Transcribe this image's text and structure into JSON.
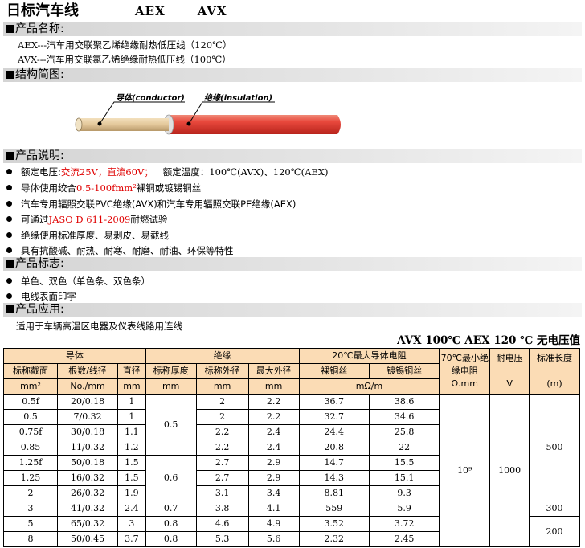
{
  "title": {
    "main": "日标汽车线",
    "code_a": "AEX",
    "code_b": "AVX"
  },
  "sections": {
    "name": "产品名称:",
    "structure": "结构简图:",
    "description": "产品说明:",
    "marking": "产品标志:",
    "application": "产品应用:"
  },
  "names": [
    "AEX---汽车用交联聚乙烯绝缘耐热低压线（120℃）",
    "AVX---汽车用交联氯乙烯绝缘耐热低压线（100℃）"
  ],
  "diagram": {
    "conductor_label": "导体(conductor)",
    "insulation_label": "绝缘(insulation)",
    "colors": {
      "insulation": "#e8483c",
      "conductor": "#e3c79a"
    }
  },
  "description": {
    "voltage_prefix": "额定电压:",
    "voltage_red": "交流25V，直流60V；",
    "voltage_suffix": "额定温度：100℃(AVX)、120℃(AEX)",
    "conductor_prefix": "导体使用绞合",
    "conductor_red": "0.5-100fmm²",
    "conductor_suffix": "裸铜或镀锡铜丝",
    "insulation": "汽车专用辐照交联PVC绝缘(AVX)和汽车专用辐照交联PE绝缘(AEX)",
    "test_prefix": "可通过",
    "test_red": "JASO D 611-2009",
    "test_suffix": "耐燃试验",
    "strip": "绝缘使用标准厚度、易剥皮、易截线",
    "resist": "具有抗酸碱、耐热、耐寒、耐磨、耐油、环保等特性"
  },
  "marking": [
    "单色、双色（单色条、双色条）",
    "电线表面印字"
  ],
  "application": "适用于车辆高温区电器及仪表线路用连线",
  "table_heading": "AVX 100℃ AEX 120 ℃ 无电压值",
  "table": {
    "groups": {
      "conductor": "导体",
      "insulation": "绝缘",
      "resistance": "20℃最大导体电阻",
      "ins_resistance": "70℃最小绝缘电阻",
      "withstand": "耐电压",
      "length": "标准长度"
    },
    "cols": {
      "area": "标称截面",
      "strand": "根数/线径",
      "dia": "直径",
      "thick": "标称厚度",
      "od_nom": "标称外径",
      "od_max": "最大外径",
      "bare": "裸铜丝",
      "tinned": "镀锡铜丝"
    },
    "units": {
      "area": "mm²",
      "strand": "No./mm",
      "dia": "mm",
      "thick": "mm",
      "od_nom": "mm",
      "od_max": "mm",
      "res": "mΩ/m",
      "ins": "Ω.mm",
      "volt": "V",
      "len": "(m)"
    },
    "rows": [
      {
        "area": "0.5f",
        "strand": "20/0.18",
        "dia": "1",
        "od_nom": "2",
        "od_max": "2.2",
        "bare": "36.7",
        "tinned": "38.6"
      },
      {
        "area": "0.5",
        "strand": "7/0.32",
        "dia": "1",
        "od_nom": "2",
        "od_max": "2.2",
        "bare": "32.7",
        "tinned": "34.6"
      },
      {
        "area": "0.75f",
        "strand": "30/0.18",
        "dia": "1.1",
        "od_nom": "2.2",
        "od_max": "2.4",
        "bare": "24.4",
        "tinned": "25.8"
      },
      {
        "area": "0.85",
        "strand": "11/0.32",
        "dia": "1.2",
        "od_nom": "2.2",
        "od_max": "2.4",
        "bare": "20.8",
        "tinned": "22"
      },
      {
        "area": "1.25f",
        "strand": "50/0.18",
        "dia": "1.5",
        "od_nom": "2.7",
        "od_max": "2.9",
        "bare": "14.7",
        "tinned": "15.5"
      },
      {
        "area": "1.25",
        "strand": "16/0.32",
        "dia": "1.5",
        "od_nom": "2.7",
        "od_max": "2.9",
        "bare": "14.3",
        "tinned": "15.1"
      },
      {
        "area": "2",
        "strand": "26/0.32",
        "dia": "1.9",
        "od_nom": "3.1",
        "od_max": "3.4",
        "bare": "8.81",
        "tinned": "9.3"
      },
      {
        "area": "3",
        "strand": "41/0.32",
        "dia": "2.4",
        "thick": "0.7",
        "od_nom": "3.8",
        "od_max": "4.1",
        "bare": "559",
        "tinned": "5.9"
      },
      {
        "area": "5",
        "strand": "65/0.32",
        "dia": "3",
        "thick": "0.8",
        "od_nom": "4.6",
        "od_max": "4.9",
        "bare": "3.52",
        "tinned": "3.72"
      },
      {
        "area": "8",
        "strand": "50/0.45",
        "dia": "3.7",
        "thick": "0.8",
        "od_nom": "5.3",
        "od_max": "5.6",
        "bare": "2.32",
        "tinned": "2.45"
      }
    ],
    "merged": {
      "thick_a": "0.5",
      "thick_b": "0.6",
      "ins_value": "10⁹",
      "volt_value": "1000",
      "len_a": "500",
      "len_b": "300",
      "len_c": "200"
    }
  }
}
